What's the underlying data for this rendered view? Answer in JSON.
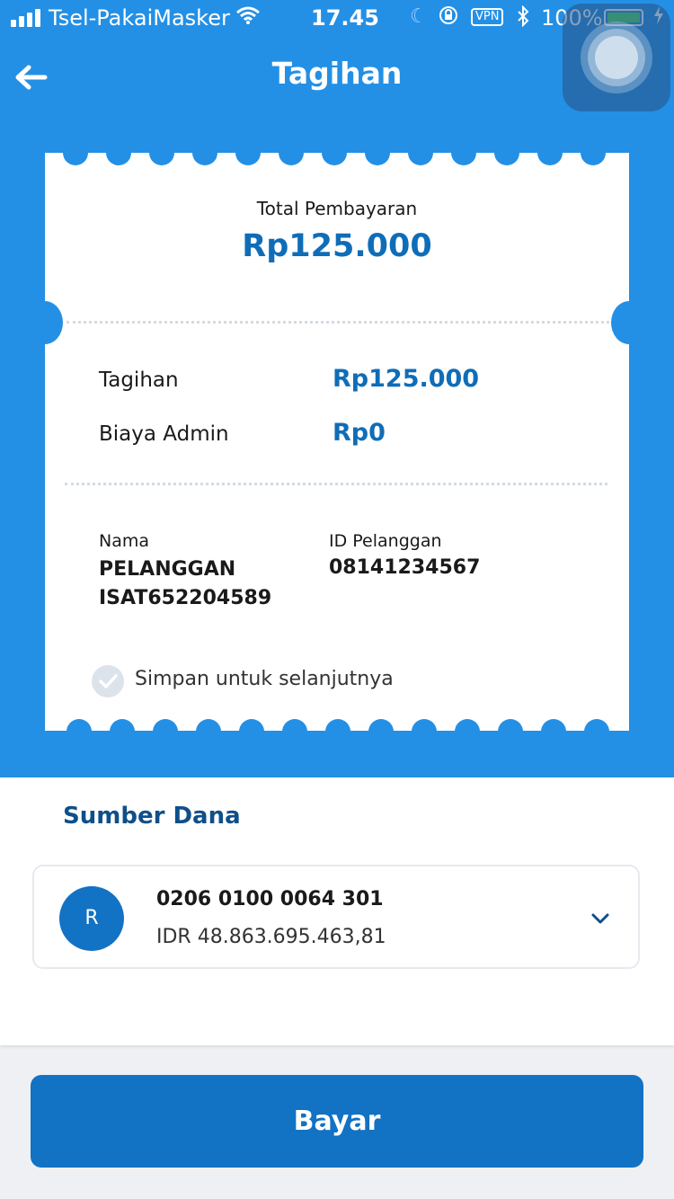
{
  "status_bar": {
    "carrier": "Tsel-PakaiMasker",
    "time": "17.45",
    "vpn": "VPN",
    "battery": "100%"
  },
  "header": {
    "title": "Tagihan"
  },
  "bill": {
    "total_label": "Total Pembayaran",
    "total_amount": "Rp125.000",
    "rows": [
      {
        "label": "Tagihan",
        "value": "Rp125.000"
      },
      {
        "label": "Biaya Admin",
        "value": "Rp0"
      }
    ],
    "name_label": "Nama",
    "name_line1": "PELANGGAN",
    "name_line2": "ISAT652204589",
    "id_label": "ID Pelanggan",
    "id_value": "08141234567",
    "save_label": "Simpan untuk selanjutnya"
  },
  "fund": {
    "title": "Sumber Dana",
    "avatar_initial": "R",
    "account_number": "0206 0100 0064 301",
    "balance": "IDR 48.863.695.463,81"
  },
  "pay_button": "Bayar",
  "colors": {
    "brand_blue": "#2390e6",
    "amount_blue": "#0f6db8",
    "button_blue": "#1272c4"
  }
}
